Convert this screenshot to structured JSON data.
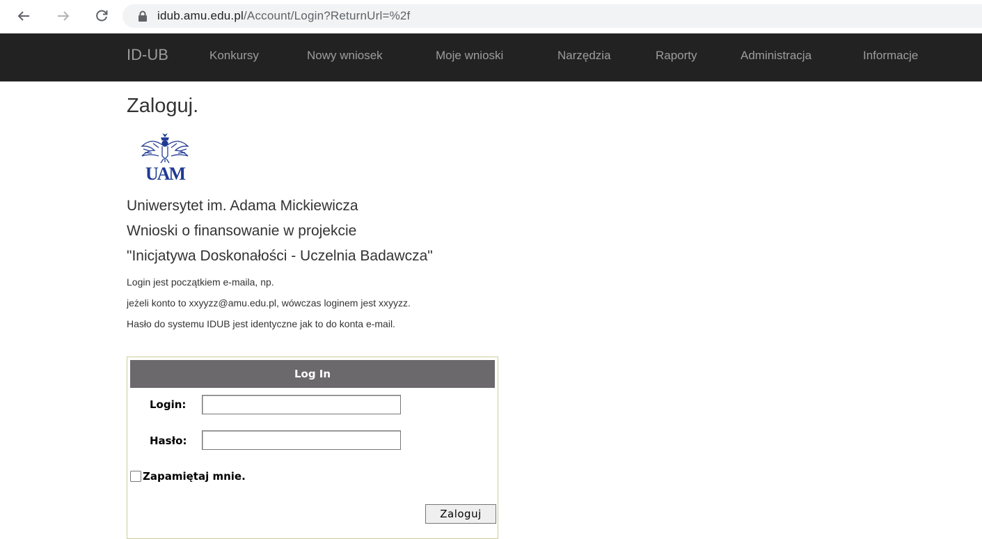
{
  "browser": {
    "url_host": "idub.amu.edu.pl",
    "url_path": "/Account/Login?ReturnUrl=%2f"
  },
  "navbar": {
    "brand": "ID-UB",
    "items": [
      {
        "label": "Konkursy"
      },
      {
        "label": "Nowy wniosek"
      },
      {
        "label": "Moje wnioski"
      },
      {
        "label": "Narzędzia"
      },
      {
        "label": "Raporty"
      },
      {
        "label": "Administracja"
      },
      {
        "label": "Informacje"
      }
    ]
  },
  "page": {
    "title": "Zaloguj.",
    "logo_text": "UAM",
    "lines_big": [
      "Uniwersytet im. Adama Mickiewicza",
      "Wnioski o finansowanie w projekcie",
      "\"Inicjatywa Doskonałości - Uczelnia Badawcza\""
    ],
    "lines_small": [
      "Login jest początkiem e-maila, np.",
      "jeżeli konto to xxyyzz@amu.edu.pl, wówczas loginem jest xxyyzz.",
      "Hasło do systemu IDUB jest identyczne jak to do konta e-mail."
    ]
  },
  "login_form": {
    "header": "Log In",
    "login_label": "Login:",
    "login_value": "",
    "password_label": "Hasło:",
    "password_value": "",
    "remember_label": "Zapamiętaj mnie.",
    "remember_checked": false,
    "submit_label": "Zaloguj"
  },
  "colors": {
    "navbar_bg": "#222222",
    "navbar_text": "#9d9d9d",
    "login_header_bg": "#6b696b",
    "login_border": "#cccc99"
  }
}
